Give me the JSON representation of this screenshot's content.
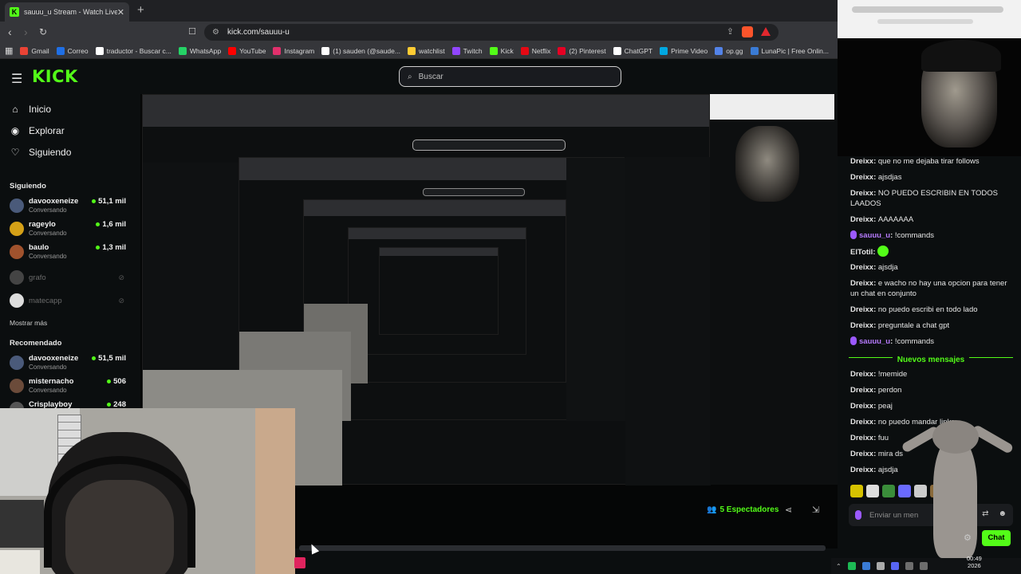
{
  "browser": {
    "tab_title": "sauuu_u Stream - Watch Live",
    "url": "kick.com/sauuu-u",
    "bookmarks": [
      {
        "label": "Gmail",
        "color": "#ea4335"
      },
      {
        "label": "Correo",
        "color": "#1f6fe5"
      },
      {
        "label": "traductor - Buscar c...",
        "color": "#ffffff"
      },
      {
        "label": "WhatsApp",
        "color": "#25d366"
      },
      {
        "label": "YouTube",
        "color": "#ff0000"
      },
      {
        "label": "Instagram",
        "color": "#e1306c"
      },
      {
        "label": "(1) sauden (@saude...",
        "color": "#ffffff"
      },
      {
        "label": "watchlist",
        "color": "#ffcc33"
      },
      {
        "label": "Twitch",
        "color": "#9146ff"
      },
      {
        "label": "Kick",
        "color": "#53fc18"
      },
      {
        "label": "Netflix",
        "color": "#e50914"
      },
      {
        "label": "(2) Pinterest",
        "color": "#e60023"
      },
      {
        "label": "ChatGPT",
        "color": "#ffffff"
      },
      {
        "label": "Prime Video",
        "color": "#00a8e1"
      },
      {
        "label": "op.gg",
        "color": "#5383e8"
      },
      {
        "label": "LunaPic | Free Onlin...",
        "color": "#3a7bd5"
      }
    ]
  },
  "kick": {
    "logo": "KICK",
    "search_placeholder": "Buscar",
    "nav": [
      {
        "label": "Inicio",
        "icon": "home-icon"
      },
      {
        "label": "Explorar",
        "icon": "compass-icon"
      },
      {
        "label": "Siguiendo",
        "icon": "heart-icon"
      }
    ],
    "following_header": "Siguiendo",
    "following": [
      {
        "name": "davooxeneize",
        "category": "Conversando",
        "viewers": "51,1 mil",
        "avatar": "#4a5a7a"
      },
      {
        "name": "rageylo",
        "category": "Conversando",
        "viewers": "1,6 mil",
        "avatar": "#d4a017"
      },
      {
        "name": "baulo",
        "category": "Conversando",
        "viewers": "1,3 mil",
        "avatar": "#a0522d"
      }
    ],
    "offline": [
      {
        "name": "grafo",
        "avatar": "#444"
      },
      {
        "name": "matecapp",
        "avatar": "#ddd"
      }
    ],
    "show_more": "Mostrar más",
    "recommended_header": "Recomendado",
    "recommended": [
      {
        "name": "davooxeneize",
        "category": "Conversando",
        "viewers": "51,5 mil",
        "avatar": "#4a5a7a"
      },
      {
        "name": "misternacho",
        "category": "Conversando",
        "viewers": "506",
        "avatar": "#6b4b3a"
      },
      {
        "name": "Crisplayboy",
        "category": "",
        "viewers": "248",
        "avatar": "#555"
      }
    ],
    "viewers_label": "5 Espectadores"
  },
  "chat": {
    "messages": [
      {
        "user": "Dreixx",
        "text": "que no me dejaba tirar follows",
        "style": "normal"
      },
      {
        "user": "Dreixx",
        "text": "ajsdjas",
        "style": "normal"
      },
      {
        "user": "Dreixx",
        "text": "NO PUEDO ESCRIBIN EN TODOS LAADOS",
        "style": "normal"
      },
      {
        "user": "Dreixx",
        "text": "AAAAAAA",
        "style": "normal"
      },
      {
        "user": "sauuu_u",
        "text": "!commands",
        "style": "purple"
      },
      {
        "user": "ElTotil",
        "text": "",
        "style": "green"
      },
      {
        "user": "Dreixx",
        "text": "ajsdja",
        "style": "normal"
      },
      {
        "user": "Dreixx",
        "text": "e wacho no hay una opcion para tener un chat en conjunto",
        "style": "normal"
      },
      {
        "user": "Dreixx",
        "text": "no puedo escribi en todo lado",
        "style": "normal"
      },
      {
        "user": "Dreixx",
        "text": "preguntale a chat gpt",
        "style": "normal"
      },
      {
        "user": "sauuu_u",
        "text": "!commands",
        "style": "purple"
      }
    ],
    "new_messages_label": "Nuevos mensajes",
    "new_messages": [
      {
        "user": "Dreixx",
        "text": "!memide"
      },
      {
        "user": "Dreixx",
        "text": "perdon"
      },
      {
        "user": "Dreixx",
        "text": "peaj"
      },
      {
        "user": "Dreixx",
        "text": "no puedo mandar links"
      },
      {
        "user": "Dreixx",
        "text": "fuu"
      },
      {
        "user": "Dreixx",
        "text": "mira ds"
      },
      {
        "user": "Dreixx",
        "text": "ajsdja"
      }
    ],
    "input_placeholder": "Enviar un men",
    "send_label": "Chat"
  },
  "taskbar": {
    "time": "00:49",
    "year": "2026"
  }
}
